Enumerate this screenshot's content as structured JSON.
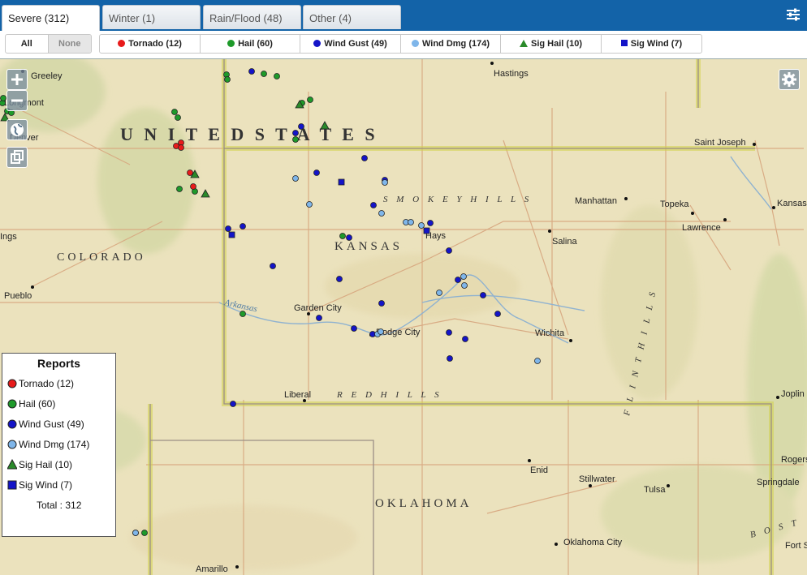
{
  "tabs": [
    {
      "label": "Severe (312)",
      "active": true
    },
    {
      "label": "Winter (1)",
      "active": false
    },
    {
      "label": "Rain/Flood (48)",
      "active": false
    },
    {
      "label": "Other (4)",
      "active": false
    }
  ],
  "filters": {
    "all_label": "All",
    "none_label": "None",
    "types": [
      {
        "label": "Tornado (12)",
        "shape": "dot",
        "color": "#e81b1b"
      },
      {
        "label": "Hail (60)",
        "shape": "dot",
        "color": "#1e9a2a"
      },
      {
        "label": "Wind Gust (49)",
        "shape": "dot",
        "color": "#1414c8"
      },
      {
        "label": "Wind Dmg (174)",
        "shape": "dot",
        "color": "#7fb6ea"
      },
      {
        "label": "Sig Hail (10)",
        "shape": "tri",
        "color": "#2a8a2a"
      },
      {
        "label": "Sig Wind (7)",
        "shape": "sq",
        "color": "#1414c8"
      }
    ]
  },
  "map": {
    "country_label": "U N I T E D   S T A T E S",
    "states": [
      "COLORADO",
      "KANSAS",
      "OKLAHOMA"
    ],
    "regions": [
      "S M O K E Y   H I L L S",
      "R E D   H I L L S",
      "F L I N T   H I L L S",
      "B O S T"
    ],
    "river": "Arkansas",
    "cities": [
      "Greeley",
      "Longmont",
      "Denver",
      "Pueblo",
      "Hastings",
      "Saint Joseph",
      "Manhattan",
      "Topeka",
      "Kansas",
      "Lawrence",
      "Salina",
      "Hays",
      "Garden City",
      "Dodge City",
      "Wichita",
      "Liberal",
      "Joplin",
      "Enid",
      "Stillwater",
      "Tulsa",
      "Rogers",
      "Springdale",
      "Oklahoma City",
      "Fort S",
      "Amarillo",
      "Ings"
    ]
  },
  "legend": {
    "title": "Reports",
    "items": [
      {
        "label": "Tornado (12)",
        "shape": "dot",
        "color": "#e81b1b"
      },
      {
        "label": "Hail (60)",
        "shape": "dot",
        "color": "#1e9a2a"
      },
      {
        "label": "Wind Gust (49)",
        "shape": "dot",
        "color": "#1414c8"
      },
      {
        "label": "Wind Dmg (174)",
        "shape": "dot",
        "color": "#7fb6ea"
      },
      {
        "label": "Sig Hail (10)",
        "shape": "tri",
        "color": "#2a8a2a"
      },
      {
        "label": "Sig Wind (7)",
        "shape": "sq",
        "color": "#1414c8"
      }
    ],
    "total": "Total : 312"
  },
  "icons": {
    "layers": "sliders-icon",
    "zoom_in": "plus-icon",
    "zoom_out": "minus-icon",
    "globe": "globe-icon",
    "copy": "copy-icon",
    "gear": "gear-icon"
  }
}
